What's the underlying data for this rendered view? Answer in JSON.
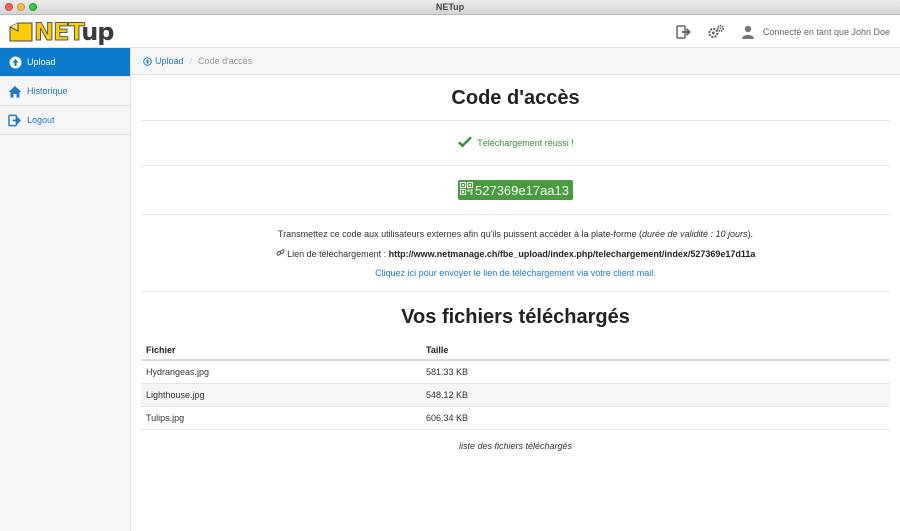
{
  "window": {
    "title": "NETup"
  },
  "brand": {
    "logo_net": "NET",
    "logo_up": "up"
  },
  "navbar": {
    "user_label": "Connecté en tant que John Doe",
    "icons": [
      "logout-icon",
      "settings-icon",
      "user-icon"
    ]
  },
  "sidebar": {
    "items": [
      {
        "label": "Upload",
        "icon": "upload-icon",
        "active": true
      },
      {
        "label": "Historique",
        "icon": "home-icon",
        "active": false
      },
      {
        "label": "Logout",
        "icon": "logout-icon",
        "active": false
      }
    ]
  },
  "breadcrumb": {
    "home": "Upload",
    "separator": "/",
    "current": "Code d'accès"
  },
  "page": {
    "title": "Code d'accès",
    "success_message": "Téléchargement réussi !",
    "access_code": "527369e17aa13",
    "instructions_pre": "Transmettez ce code aux utilisateurs externes afin qu'ils puissent accéder à la plate-forme (",
    "instructions_italic": "durée de validité : 10 jours",
    "instructions_post": ").",
    "link_label": "Lien de téléchargement :",
    "link_url": "http://www.netmanage.ch/fbe_upload/index.php/telechargement/index/527369e17d11a",
    "mail_link": "Cliquez ici pour envoyer le lien de téléchargement via votre client mail.",
    "files_title": "Vos fichiers téléchargés"
  },
  "files_table": {
    "headers": {
      "file": "Fichier",
      "size": "Taille"
    },
    "rows": [
      {
        "file": "Hydrangeas.jpg",
        "size": "581.33 KB"
      },
      {
        "file": "Lighthouse.jpg",
        "size": "548.12 KB"
      },
      {
        "file": "Tulips.jpg",
        "size": "606.34 KB"
      }
    ],
    "caption": "liste des fichiers téléchargés"
  },
  "colors": {
    "accent": "#0d7bcc",
    "link": "#1f7ac6",
    "success": "#3a8b3a",
    "code_badge": "#4a9a3f",
    "logo_yellow": "#ffcb05"
  }
}
